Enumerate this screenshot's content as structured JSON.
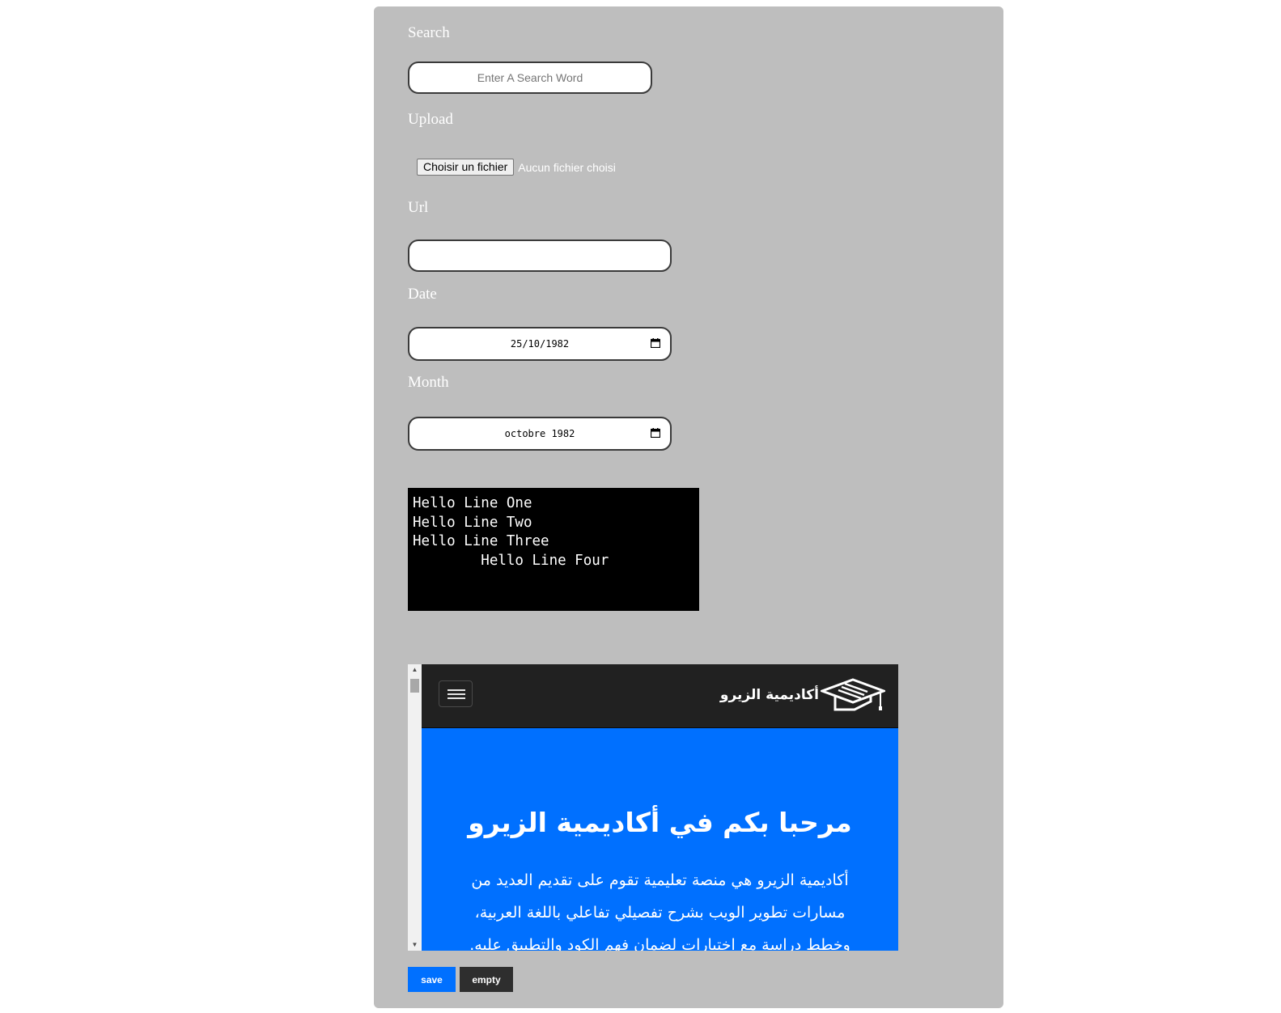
{
  "form": {
    "search": {
      "label": "Search",
      "placeholder": "Enter A Search Word"
    },
    "upload": {
      "label": "Upload",
      "button_label": "Choisir un fichier",
      "status": "Aucun fichier choisi"
    },
    "url": {
      "label": "Url",
      "value": ""
    },
    "date": {
      "label": "Date",
      "value": "25/10/1982",
      "icon": "calendar-icon"
    },
    "month": {
      "label": "Month",
      "value": "octobre 1982",
      "icon": "calendar-icon"
    },
    "code_block": {
      "lines": "Hello Line One\nHello Line Two\nHello Line Three\n        Hello Line Four"
    },
    "embedded_site": {
      "brand": "أكاديمية الزيرو",
      "menu_icon": "hamburger-menu-icon",
      "logo_icon": "graduation-cap-icon",
      "hero_title": "مرحبا بكم في أكاديمية الزيرو",
      "hero_text": "أكاديمية الزيرو هي منصة تعليمية تقوم على تقديم العديد من مسارات تطوير الويب بشرح تفصيلي تفاعلي باللغة العربية، وخطط دراسة مع اختبارات لضمان فهم الكود والتطبيق عليه.",
      "hero_color": "#0070ff",
      "nav_color": "#212121"
    },
    "buttons": {
      "save_label": "save",
      "empty_label": "empty"
    }
  },
  "colors": {
    "panel_background": "#bebebe",
    "save_button": "#0070ff",
    "empty_button": "#2e2e2e"
  }
}
